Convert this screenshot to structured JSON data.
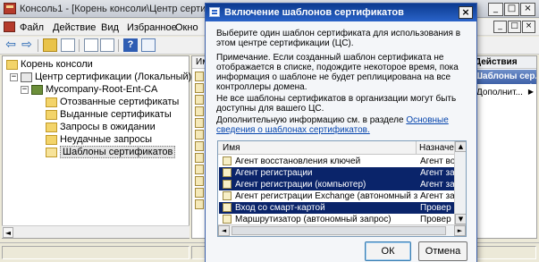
{
  "window": {
    "title": "Консоль1 - [Корень консоли\\Центр сертиф",
    "min": "_",
    "max": "□",
    "close": "×"
  },
  "menu": [
    "Файл",
    "Действие",
    "Вид",
    "Избранное",
    "Окно",
    "С"
  ],
  "mdi": {
    "min": "_",
    "max": "□",
    "close": "×"
  },
  "toolbar": {
    "back": "⇦",
    "forward": "⇨",
    "help": "?"
  },
  "tree": {
    "root": "Корень консоли",
    "ca": "Центр сертификации (Локальный)",
    "server": "Mycompany-Root-Ent-CA",
    "folders": [
      "Отозванные сертификаты",
      "Выданные сертификаты",
      "Запросы в ожидании",
      "Неудачные запросы",
      "Шаблоны сертификатов"
    ],
    "collapse_glyph": "−",
    "scroll_left": "◄"
  },
  "result_pane": {
    "column": "Имя"
  },
  "actions_pane": {
    "header": "Действия",
    "section": "Шаблоны сер...",
    "section_arrow": "▲",
    "item": "Дополнит...",
    "item_arrow": "▶"
  },
  "dialog": {
    "title": "Включение шаблонов сертификатов",
    "close": "×",
    "p1": "Выберите один шаблон сертификата для использования в этом центре сертификации (ЦС).",
    "p2": "Примечание. Если созданный шаблон сертификата не отображается в списке, подождите некоторое время, пока информация о шаблоне не будет реплицирована на все контроллеры домена.",
    "p3": "Не все шаблоны сертификатов в организации могут быть доступны для вашего ЦС.",
    "p4_prefix": "Дополнительную информацию см. в разделе ",
    "p4_link": "Основные сведения о шаблонах сертификатов.",
    "list": {
      "col_name": "Имя",
      "col_purpose": "Назначе",
      "rows": [
        {
          "name": "Агент восстановления ключей",
          "purpose": "Агент во",
          "selected": false
        },
        {
          "name": "Агент регистрации",
          "purpose": "Агент за",
          "selected": true
        },
        {
          "name": "Агент регистрации (компьютер)",
          "purpose": "Агент за",
          "selected": true
        },
        {
          "name": "Агент регистрации Exchange (автономный запрос)",
          "purpose": "Агент за",
          "selected": false
        },
        {
          "name": "Вход со смарт-картой",
          "purpose": "Провер",
          "selected": true
        },
        {
          "name": "Маршрутизатор (автономный запрос)",
          "purpose": "Провер",
          "selected": false
        }
      ],
      "scroll_up": "▲",
      "scroll_down": "▼",
      "scroll_left": "◄",
      "scroll_right": "►"
    },
    "ok": "ОК",
    "cancel": "Отмена"
  }
}
